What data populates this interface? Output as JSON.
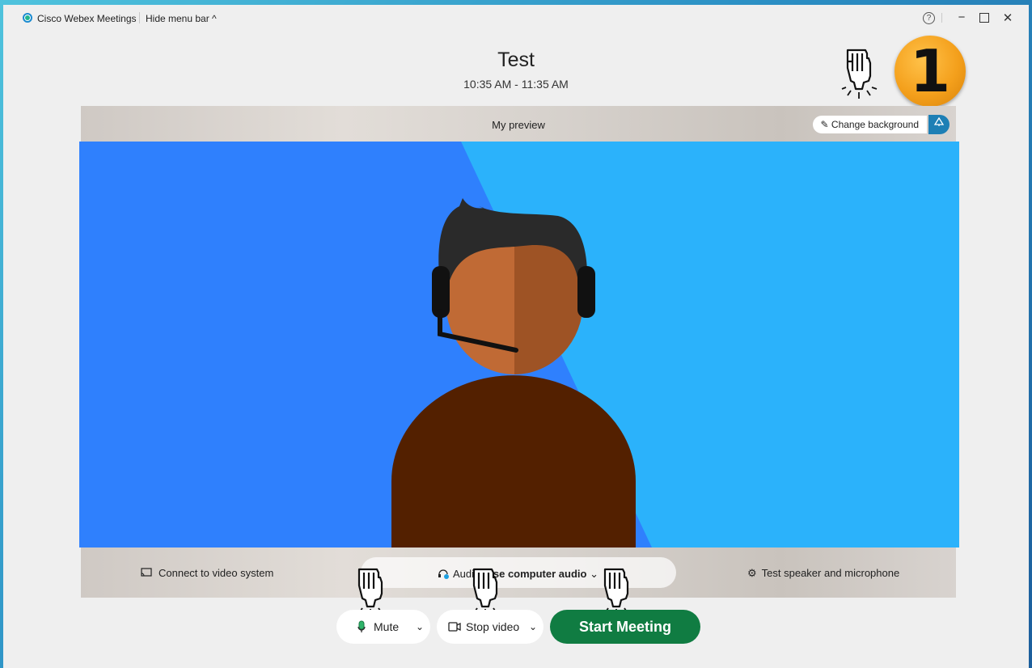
{
  "titlebar": {
    "app_name": "Cisco Webex Meetings",
    "hide_menu_label": "Hide menu bar ^",
    "help_glyph": "?",
    "minimize_glyph": "−",
    "close_glyph": "✕"
  },
  "meeting": {
    "title": "Test",
    "time": "10:35 AM - 11:35 AM"
  },
  "step_badge": "1",
  "preview": {
    "label": "My preview",
    "change_background_label": "Change background"
  },
  "controls": {
    "connect_label": "Connect to video system",
    "audio_prefix": "Audio: ",
    "audio_value": "Use computer audio",
    "test_speaker_label": "Test speaker and microphone"
  },
  "buttons": {
    "mute_label": "Mute",
    "stop_video_label": "Stop video",
    "start_meeting_label": "Start Meeting"
  },
  "colors": {
    "start_button": "#107c42",
    "accent": "#1d7fb5",
    "badge": "#f4a01c",
    "bg_left": "#2f80fd",
    "bg_right": "#2bb2fb"
  },
  "icons": [
    "cisco-webex-logo-icon",
    "help-icon",
    "magic-wand-icon",
    "cast-icon",
    "headset-icon",
    "gear-icon",
    "microphone-icon",
    "camera-icon",
    "pointing-hand-icon"
  ]
}
